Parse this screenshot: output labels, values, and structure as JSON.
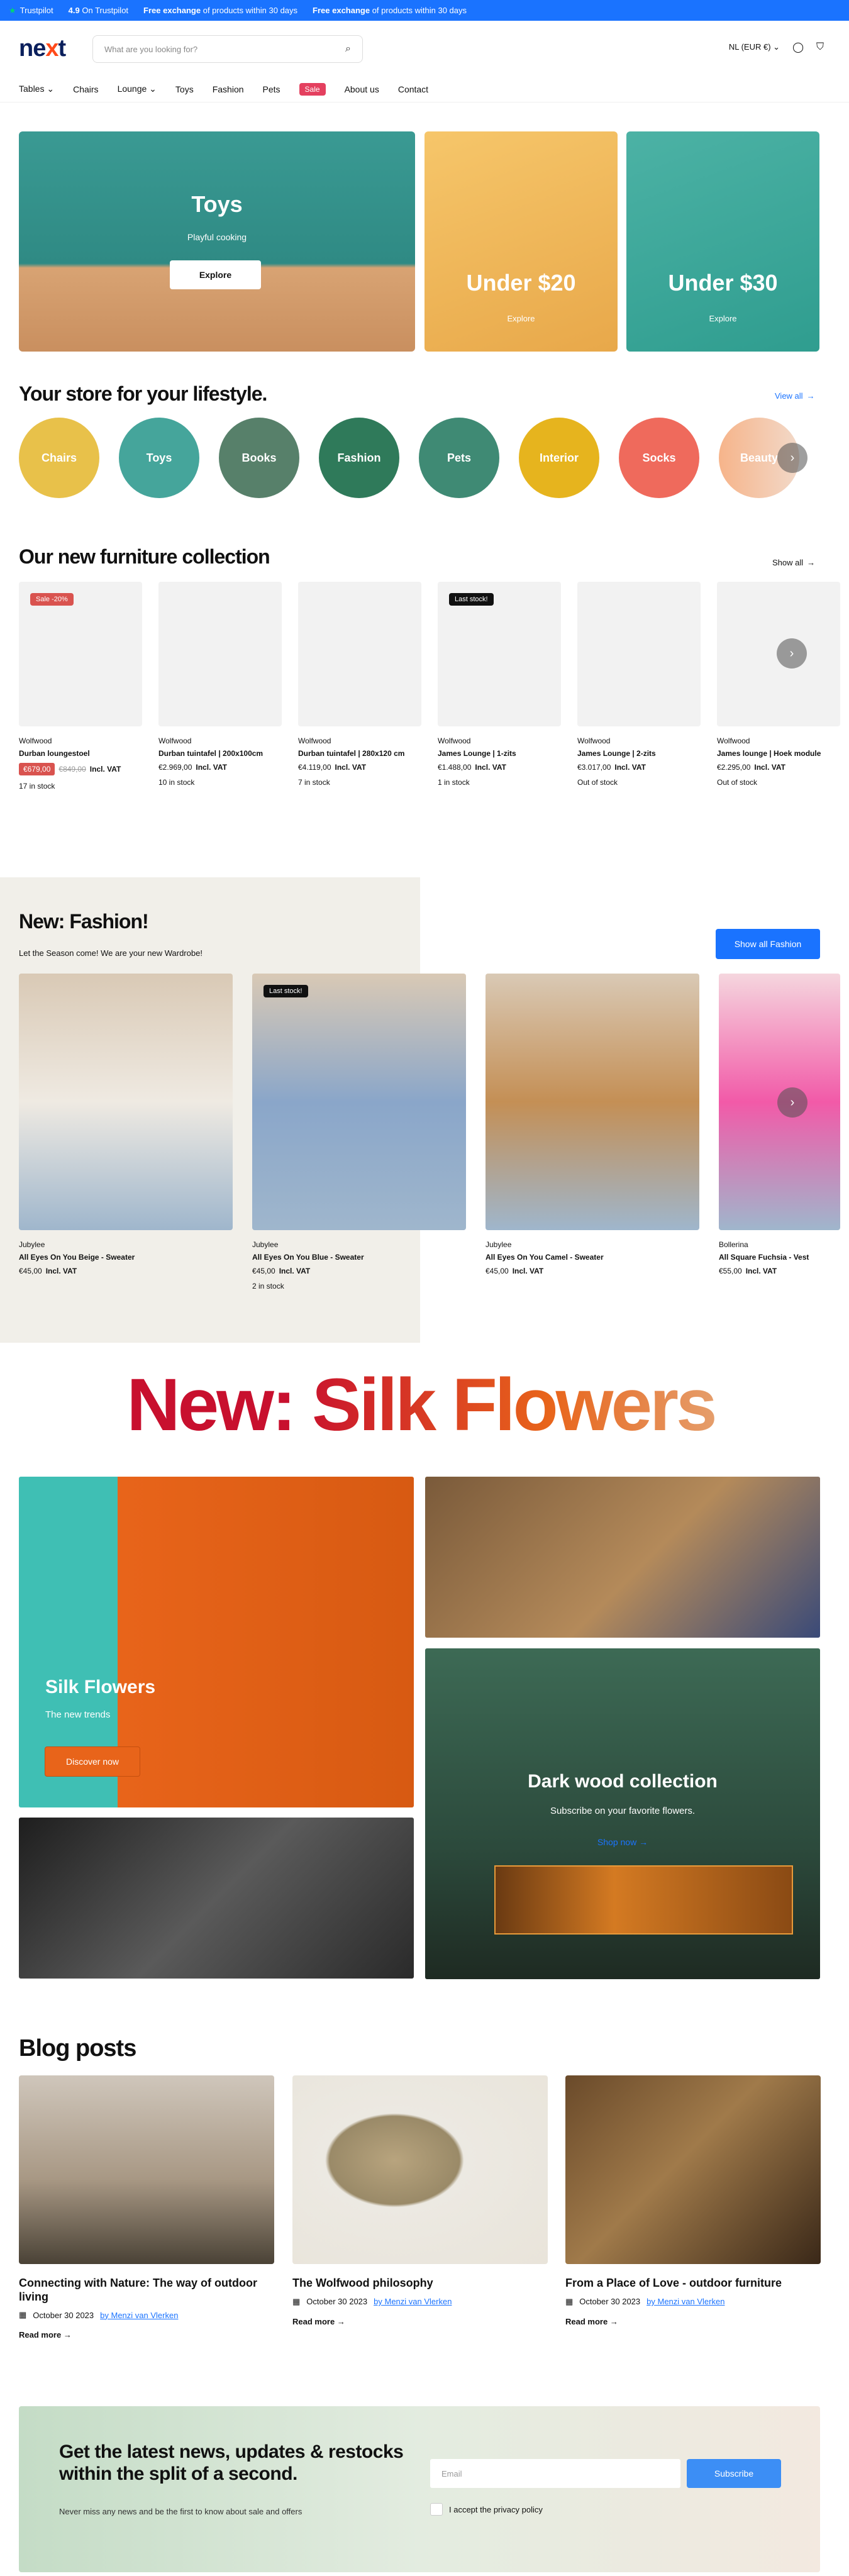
{
  "topbar": {
    "trust": "Trustpilot",
    "rating": "4.9",
    "rating_label": "On Trustpilot",
    "msg1_bold": "Free exchange",
    "msg1": "of products within 30 days",
    "msg2_bold": "Free exchange",
    "msg2": "of products within 30 days"
  },
  "header": {
    "logo_a": "ne",
    "logo_b": "x",
    "logo_c": "t",
    "search_placeholder": "What are you looking for?",
    "locale": "NL (EUR €)"
  },
  "nav": [
    "Tables",
    "Chairs",
    "Lounge",
    "Toys",
    "Fashion",
    "Pets",
    "Sale",
    "About us",
    "Contact"
  ],
  "hero": {
    "toys_title": "Toys",
    "toys_sub": "Playful cooking",
    "toys_btn": "Explore",
    "u20": "Under $20",
    "u20_btn": "Explore",
    "u30": "Under $30",
    "u30_btn": "Explore"
  },
  "lifestyle": {
    "title": "Your store for your lifestyle.",
    "view_all": "View all",
    "items": [
      "Chairs",
      "Toys",
      "Books",
      "Fashion",
      "Pets",
      "Interior",
      "Socks",
      "Beauty"
    ]
  },
  "furniture": {
    "title": "Our new furniture collection",
    "show_all": "Show all",
    "products": [
      {
        "brand": "Wolfwood",
        "name": "Durban loungestoel",
        "price": "€679,00",
        "old": "€849,00",
        "vat": "Incl. VAT",
        "stock": "17 in stock",
        "badge": "Sale -20%"
      },
      {
        "brand": "Wolfwood",
        "name": "Durban tuintafel | 200x100cm",
        "price": "€2.969,00",
        "vat": "Incl. VAT",
        "stock": "10 in stock"
      },
      {
        "brand": "Wolfwood",
        "name": "Durban tuintafel | 280x120 cm",
        "price": "€4.119,00",
        "vat": "Incl. VAT",
        "stock": "7 in stock"
      },
      {
        "brand": "Wolfwood",
        "name": "James Lounge | 1-zits",
        "price": "€1.488,00",
        "vat": "Incl. VAT",
        "stock": "1 in stock",
        "badge": "Last stock!"
      },
      {
        "brand": "Wolfwood",
        "name": "James Lounge | 2-zits",
        "price": "€3.017,00",
        "vat": "Incl. VAT",
        "stock": "Out of stock"
      },
      {
        "brand": "Wolfwood",
        "name": "James lounge | Hoek module",
        "price": "€2.295,00",
        "vat": "Incl. VAT",
        "stock": "Out of stock"
      }
    ]
  },
  "fashion": {
    "title": "New: Fashion!",
    "sub": "Let the Season come! We are your new Wardrobe!",
    "btn": "Show all Fashion",
    "products": [
      {
        "brand": "Jubylee",
        "name": "All Eyes On You Beige - Sweater",
        "price": "€45,00",
        "vat": "Incl. VAT",
        "stock": ""
      },
      {
        "brand": "Jubylee",
        "name": "All Eyes On You Blue - Sweater",
        "price": "€45,00",
        "vat": "Incl. VAT",
        "stock": "2 in stock",
        "badge": "Last stock!"
      },
      {
        "brand": "Jubylee",
        "name": "All Eyes On You Camel - Sweater",
        "price": "€45,00",
        "vat": "Incl. VAT",
        "stock": ""
      },
      {
        "brand": "Bollerina",
        "name": "All Square Fuchsia - Vest",
        "price": "€55,00",
        "vat": "Incl. VAT",
        "stock": ""
      }
    ]
  },
  "silk": {
    "headline": "New: Silk Flowers",
    "card_title": "Silk Flowers",
    "card_sub": "The new trends",
    "card_btn": "Discover now",
    "dark_title": "Dark wood collection",
    "dark_sub": "Subscribe on your favorite flowers.",
    "dark_link": "Shop now"
  },
  "blog": {
    "title": "Blog posts",
    "read": "Read more",
    "posts": [
      {
        "title": "Connecting with Nature: The way of outdoor living",
        "date": "October 30 2023",
        "author": "by Menzi van Vlerken"
      },
      {
        "title": "The Wolfwood philosophy",
        "date": "October 30 2023",
        "author": "by Menzi van Vlerken"
      },
      {
        "title": "From a Place of Love - outdoor furniture",
        "date": "October 30 2023",
        "author": "by Menzi van Vlerken"
      }
    ]
  },
  "newsletter": {
    "title": "Get the latest news, updates & restocks within the split of a second.",
    "sub": "Never miss any news and be the first to know about sale and offers",
    "email_placeholder": "Email",
    "btn": "Subscribe",
    "privacy": "I accept the privacy policy"
  },
  "colors": {
    "accent": "#1a73ff",
    "sale": "#e4405f",
    "brand": "#0a1f5c",
    "orange": "#e8641a"
  }
}
